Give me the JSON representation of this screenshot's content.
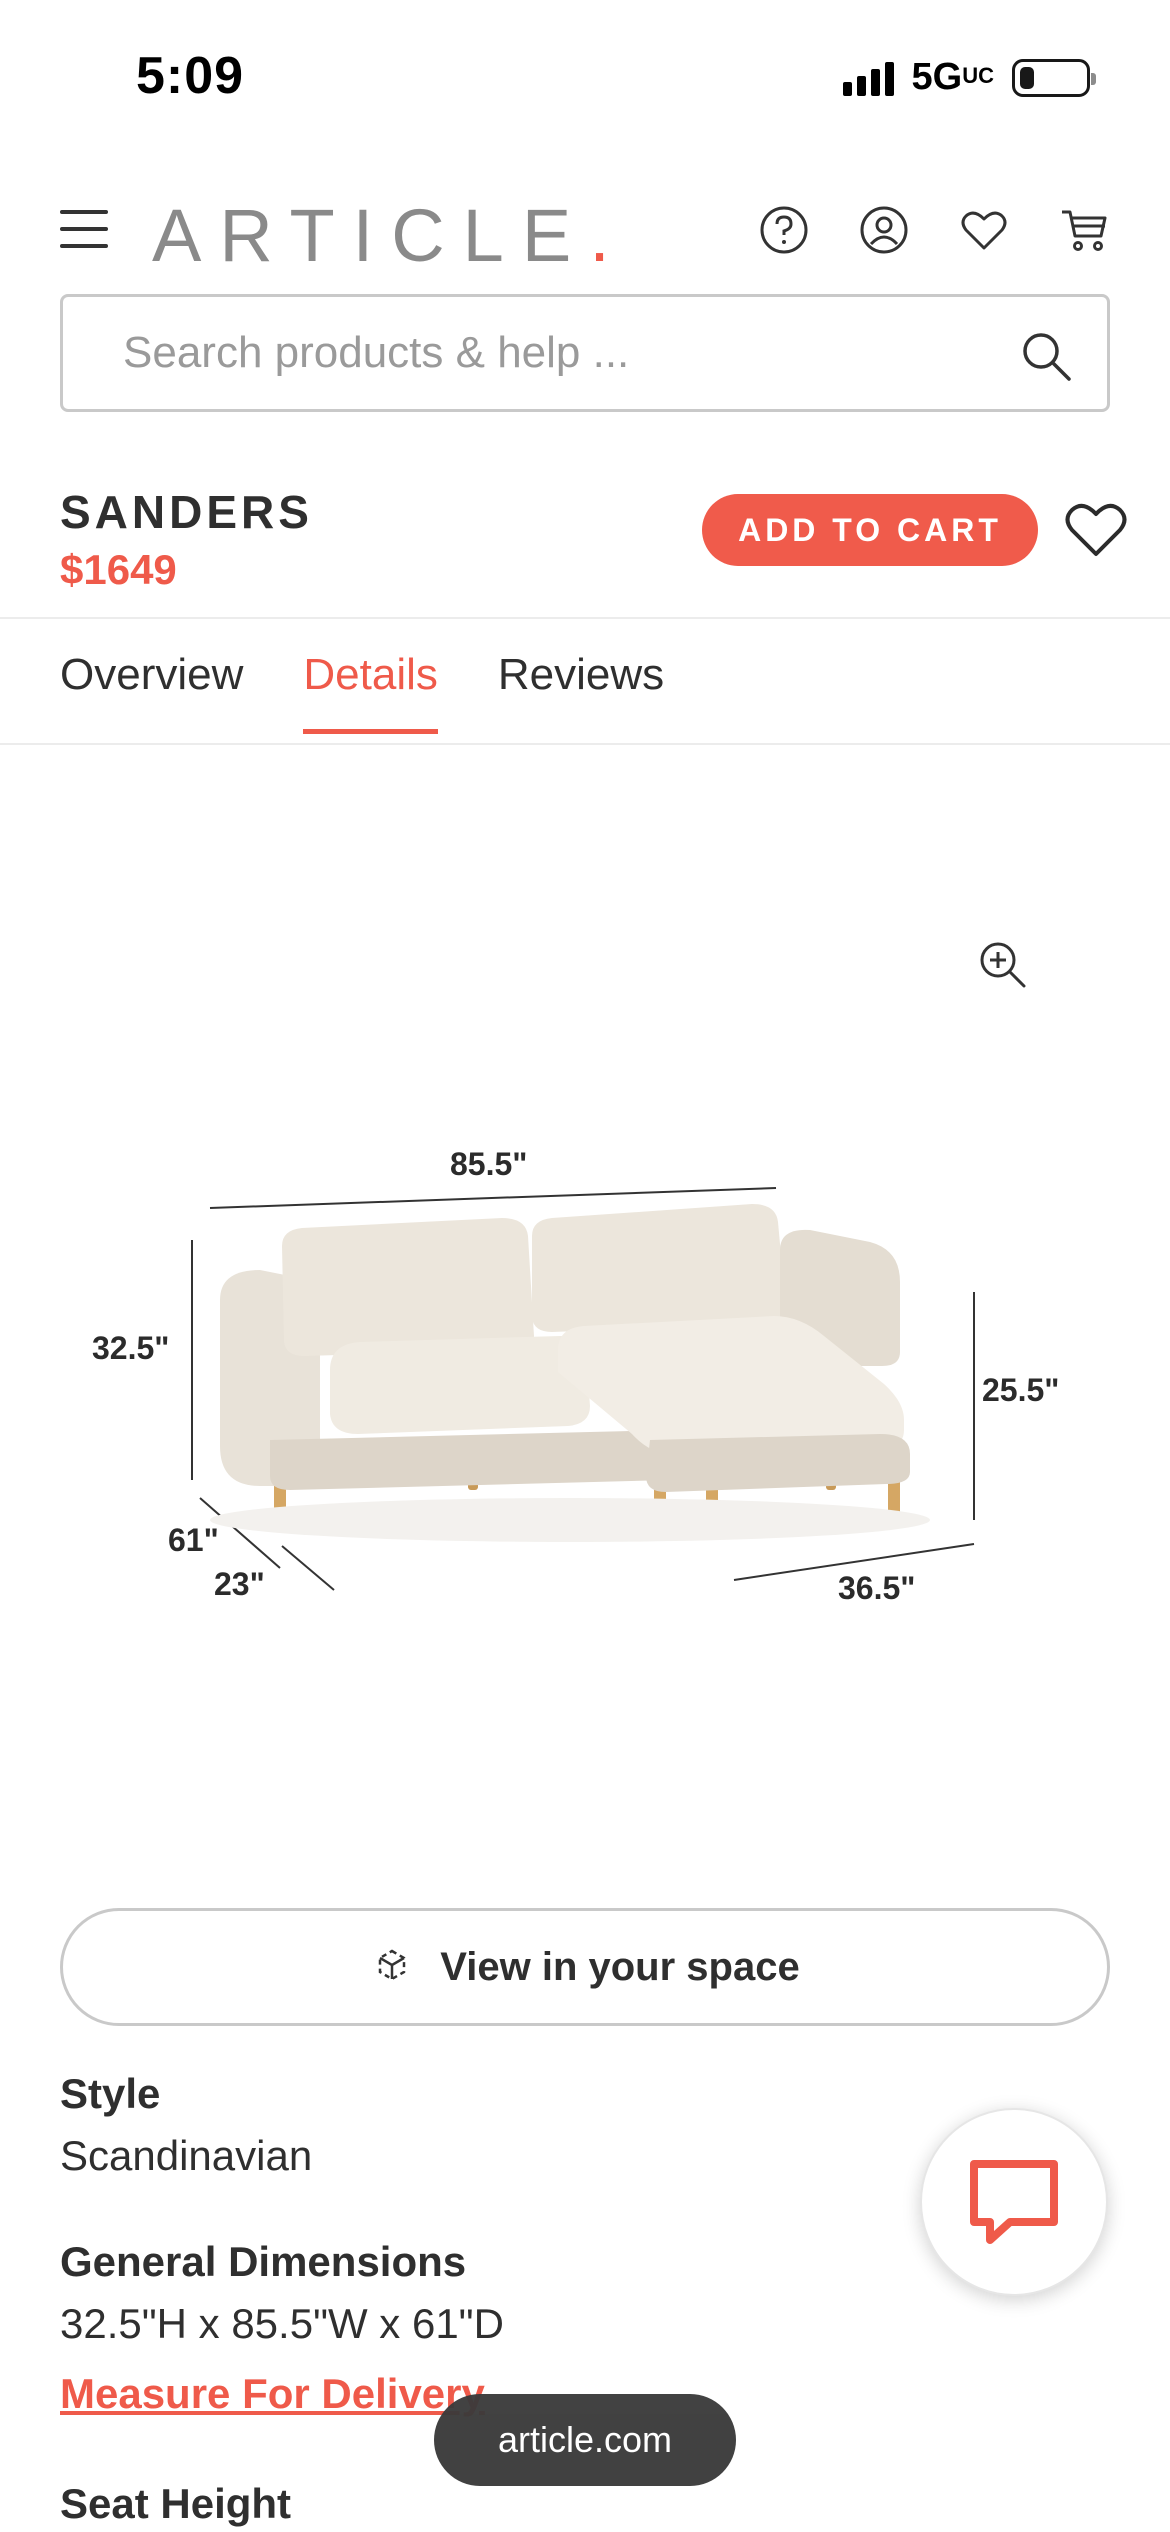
{
  "status_bar": {
    "time": "5:09",
    "network": "5G",
    "network_suffix": "UC"
  },
  "header": {
    "logo": "ARTICLE",
    "logo_dot": ".",
    "brand_color": "#ef5a4a",
    "icons": [
      "menu-icon",
      "help-icon",
      "account-icon",
      "heart-icon",
      "cart-icon"
    ]
  },
  "search": {
    "placeholder": "Search products & help ..."
  },
  "product": {
    "name": "SANDERS",
    "price": "$1649",
    "add_to_cart": "ADD TO CART"
  },
  "tabs": [
    {
      "label": "Overview",
      "active": false
    },
    {
      "label": "Details",
      "active": true
    },
    {
      "label": "Reviews",
      "active": false
    }
  ],
  "image": {
    "dimensions": {
      "width": "85.5\"",
      "height": "32.5\"",
      "chaise_height": "25.5\"",
      "depth": "61\"",
      "seat_depth": "23\"",
      "chaise_width": "36.5\""
    }
  },
  "view_in_space": {
    "label": "View in your space"
  },
  "specs": {
    "style_label": "Style",
    "style_value": "Scandinavian",
    "dimensions_label": "General Dimensions",
    "dimensions_value": "32.5\"H x 85.5\"W x 61\"D",
    "measure_link": "Measure For Delivery",
    "seat_height_label": "Seat Height"
  },
  "browser": {
    "url": "article.com"
  }
}
